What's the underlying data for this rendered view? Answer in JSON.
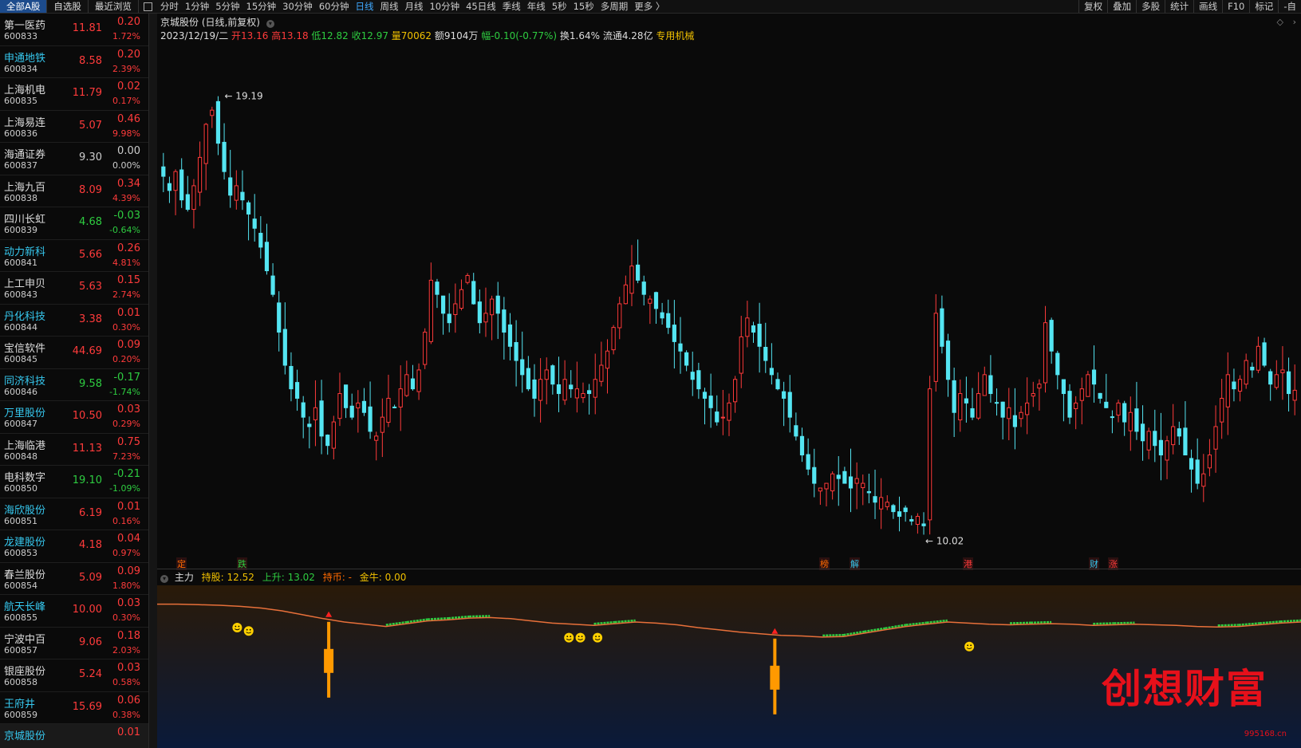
{
  "top_tabs": [
    "全部A股",
    "自选股",
    "最近浏览"
  ],
  "periods": [
    "分时",
    "1分钟",
    "5分钟",
    "15分钟",
    "30分钟",
    "60分钟",
    "日线",
    "周线",
    "月线",
    "10分钟",
    "45日线",
    "季线",
    "年线",
    "5秒",
    "15秒",
    "多周期",
    "更多 〉"
  ],
  "active_period": "日线",
  "right_tools": [
    "复权",
    "叠加",
    "多股",
    "统计",
    "画线",
    "F10",
    "标记",
    "-自"
  ],
  "stocks": [
    {
      "name": "第一医药",
      "code": "600833",
      "price": "11.81",
      "change": "0.20",
      "pct": "1.72%",
      "dir": "up",
      "ncolor": "wh"
    },
    {
      "name": "申通地铁",
      "code": "600834",
      "price": "8.58",
      "change": "0.20",
      "pct": "2.39%",
      "dir": "up",
      "ncolor": "cy"
    },
    {
      "name": "上海机电",
      "code": "600835",
      "price": "11.79",
      "change": "0.02",
      "pct": "0.17%",
      "dir": "up",
      "ncolor": "wh"
    },
    {
      "name": "上海易连",
      "code": "600836",
      "price": "5.07",
      "change": "0.46",
      "pct": "9.98%",
      "dir": "up",
      "ncolor": "wh"
    },
    {
      "name": "海通证券",
      "code": "600837",
      "price": "9.30",
      "change": "0.00",
      "pct": "0.00%",
      "dir": "fl",
      "ncolor": "wh"
    },
    {
      "name": "上海九百",
      "code": "600838",
      "price": "8.09",
      "change": "0.34",
      "pct": "4.39%",
      "dir": "up",
      "ncolor": "wh"
    },
    {
      "name": "四川长虹",
      "code": "600839",
      "price": "4.68",
      "change": "-0.03",
      "pct": "-0.64%",
      "dir": "dn",
      "ncolor": "wh"
    },
    {
      "name": "动力新科",
      "code": "600841",
      "price": "5.66",
      "change": "0.26",
      "pct": "4.81%",
      "dir": "up",
      "ncolor": "cy"
    },
    {
      "name": "上工申贝",
      "code": "600843",
      "price": "5.63",
      "change": "0.15",
      "pct": "2.74%",
      "dir": "up",
      "ncolor": "wh"
    },
    {
      "name": "丹化科技",
      "code": "600844",
      "price": "3.38",
      "change": "0.01",
      "pct": "0.30%",
      "dir": "up",
      "ncolor": "cy"
    },
    {
      "name": "宝信软件",
      "code": "600845",
      "price": "44.69",
      "change": "0.09",
      "pct": "0.20%",
      "dir": "up",
      "ncolor": "wh"
    },
    {
      "name": "同济科技",
      "code": "600846",
      "price": "9.58",
      "change": "-0.17",
      "pct": "-1.74%",
      "dir": "dn",
      "ncolor": "cy"
    },
    {
      "name": "万里股份",
      "code": "600847",
      "price": "10.50",
      "change": "0.03",
      "pct": "0.29%",
      "dir": "up",
      "ncolor": "cy"
    },
    {
      "name": "上海临港",
      "code": "600848",
      "price": "11.13",
      "change": "0.75",
      "pct": "7.23%",
      "dir": "up",
      "ncolor": "wh"
    },
    {
      "name": "电科数字",
      "code": "600850",
      "price": "19.10",
      "change": "-0.21",
      "pct": "-1.09%",
      "dir": "dn",
      "ncolor": "wh"
    },
    {
      "name": "海欣股份",
      "code": "600851",
      "price": "6.19",
      "change": "0.01",
      "pct": "0.16%",
      "dir": "up",
      "ncolor": "cy"
    },
    {
      "name": "龙建股份",
      "code": "600853",
      "price": "4.18",
      "change": "0.04",
      "pct": "0.97%",
      "dir": "up",
      "ncolor": "cy"
    },
    {
      "name": "春兰股份",
      "code": "600854",
      "price": "5.09",
      "change": "0.09",
      "pct": "1.80%",
      "dir": "up",
      "ncolor": "wh"
    },
    {
      "name": "航天长峰",
      "code": "600855",
      "price": "10.00",
      "change": "0.03",
      "pct": "0.30%",
      "dir": "up",
      "ncolor": "cy"
    },
    {
      "name": "宁波中百",
      "code": "600857",
      "price": "9.06",
      "change": "0.18",
      "pct": "2.03%",
      "dir": "up",
      "ncolor": "wh"
    },
    {
      "name": "银座股份",
      "code": "600858",
      "price": "5.24",
      "change": "0.03",
      "pct": "0.58%",
      "dir": "up",
      "ncolor": "wh"
    },
    {
      "name": "王府井",
      "code": "600859",
      "price": "15.69",
      "change": "0.06",
      "pct": "0.38%",
      "dir": "up",
      "ncolor": "cy"
    },
    {
      "name": "京城股份",
      "code": "",
      "price": "",
      "change": "0.01",
      "pct": "",
      "dir": "up",
      "ncolor": "cy"
    }
  ],
  "chart_header": {
    "title": "京城股份 (日线,前复权)",
    "date": "2023/12/19/二",
    "open_label": "开13.16",
    "high_label": "高13.18",
    "low_label": "低12.82",
    "close_label": "收12.97",
    "vol_label": "量70062",
    "amount_label": "额9104万",
    "range_label": "幅-0.10(-0.77%)",
    "turnover_label": "换1.64%",
    "float_label": "流通4.28亿",
    "sector_label": "专用机械"
  },
  "indicator_header": {
    "name": "主力",
    "hold_label": "持股: 12.52",
    "rise_label": "上升: 13.02",
    "coin_label": "持币: -",
    "gold_label": "金牛: 0.00"
  },
  "event_markers": [
    "定",
    "跌",
    "榜",
    "解",
    "港",
    "财",
    "涨"
  ],
  "watermark": "创想财富",
  "watermark_url": "995168.cn",
  "chart_data": {
    "type": "candlestick",
    "title": "京城股份 (日线,前复权)",
    "max_label": "19.19",
    "min_label": "10.02",
    "ylim": [
      9.6,
      20.0
    ],
    "close": [
      17.5,
      17.2,
      17.6,
      17.0,
      16.8,
      17.3,
      17.9,
      18.6,
      18.9,
      18.2,
      17.6,
      17.1,
      17.3,
      17.0,
      16.7,
      16.4,
      16.0,
      15.5,
      15.0,
      14.2,
      13.5,
      13.0,
      12.8,
      12.4,
      12.2,
      12.6,
      12.0,
      11.8,
      12.3,
      12.9,
      12.6,
      12.4,
      12.7,
      12.5,
      12.1,
      12.0,
      12.4,
      12.8,
      12.6,
      13.0,
      13.3,
      13.0,
      13.4,
      14.2,
      15.3,
      15.0,
      14.6,
      14.4,
      14.8,
      15.1,
      15.4,
      14.8,
      14.4,
      14.6,
      14.9,
      14.6,
      14.2,
      13.9,
      13.6,
      13.3,
      13.0,
      12.8,
      13.2,
      13.4,
      13.1,
      12.9,
      13.2,
      13.0,
      13.0,
      12.9,
      12.9,
      13.2,
      13.5,
      13.8,
      14.3,
      14.8,
      15.2,
      15.6,
      15.3,
      15.0,
      14.9,
      14.7,
      14.5,
      14.3,
      14.0,
      13.8,
      13.5,
      13.2,
      13.0,
      12.8,
      12.6,
      12.3,
      12.4,
      12.7,
      13.2,
      14.1,
      14.5,
      14.2,
      13.9,
      13.6,
      13.3,
      13.0,
      12.8,
      12.4,
      12.0,
      11.6,
      11.3,
      11.0,
      10.9,
      11.0,
      11.2,
      11.1,
      11.0,
      10.9,
      11.1,
      11.0,
      10.8,
      10.6,
      10.7,
      10.6,
      10.4,
      10.3,
      10.4,
      10.2,
      10.3,
      10.1,
      13.0,
      14.6,
      13.9,
      13.2,
      12.5,
      12.9,
      12.7,
      12.4,
      12.9,
      13.3,
      12.9,
      12.7,
      12.4,
      12.6,
      12.2,
      12.5,
      12.7,
      12.9,
      13.1,
      14.4,
      13.8,
      13.3,
      12.9,
      12.4,
      12.7,
      13.0,
      13.3,
      13.1,
      12.8,
      12.6,
      12.4,
      12.7,
      12.3,
      12.5,
      12.1,
      11.9,
      12.1,
      11.8,
      11.6,
      11.9,
      12.2,
      12.0,
      11.6,
      11.3,
      11.0,
      11.2,
      11.6,
      12.2,
      12.8,
      13.3,
      13.0,
      13.2,
      13.6,
      13.4,
      13.9,
      13.5,
      13.1,
      13.3,
      13.4,
      12.9,
      12.97
    ],
    "series_colors": {
      "up": "#ff3b3b",
      "down": "#54e5f2"
    },
    "indicator": {
      "name": "主力",
      "line": [
        0.92,
        0.92,
        0.91,
        0.9,
        0.88,
        0.85,
        0.8,
        0.73,
        0.66,
        0.6,
        0.56,
        0.52,
        0.57,
        0.62,
        0.64,
        0.67,
        0.68,
        0.66,
        0.62,
        0.58,
        0.56,
        0.54,
        0.57,
        0.6,
        0.58,
        0.55,
        0.5,
        0.46,
        0.42,
        0.39,
        0.36,
        0.35,
        0.33,
        0.34,
        0.4,
        0.46,
        0.52,
        0.56,
        0.6,
        0.58,
        0.56,
        0.55,
        0.56,
        0.57,
        0.56,
        0.54,
        0.55,
        0.56,
        0.55,
        0.54,
        0.52,
        0.51,
        0.52,
        0.55,
        0.58,
        0.6
      ],
      "signals": [
        0.15,
        0.54
      ]
    }
  }
}
